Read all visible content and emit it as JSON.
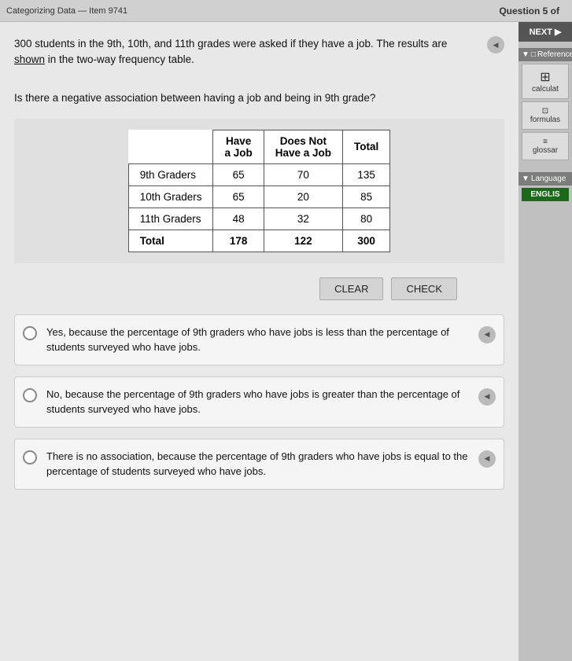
{
  "header": {
    "title": "Categorizing Data — Item 9741",
    "question_indicator": "Question 5 of"
  },
  "question": {
    "text_part1": "300 students in the 9th, 10th, and 11th grades were asked if they have a job. The results are ",
    "text_link": "shown",
    "text_part2": " in the two-way frequency table.",
    "sub_question": "Is there a negative association between having a job and being in 9th grade?"
  },
  "table": {
    "headers": [
      "",
      "Have a Job",
      "Does Not Have a Job",
      "Total"
    ],
    "rows": [
      [
        "9th Graders",
        "65",
        "70",
        "135"
      ],
      [
        "10th Graders",
        "65",
        "20",
        "85"
      ],
      [
        "11th Graders",
        "48",
        "32",
        "80"
      ],
      [
        "Total",
        "178",
        "122",
        "300"
      ]
    ]
  },
  "buttons": {
    "clear": "CLEAR",
    "check": "CHECK"
  },
  "answers": [
    {
      "id": "A",
      "text": "Yes, because the percentage of 9th graders who have jobs is less than the percentage of students surveyed who have jobs."
    },
    {
      "id": "B",
      "text": "No, because the percentage of 9th graders who have jobs is greater than the percentage of students surveyed who have jobs."
    },
    {
      "id": "C",
      "text": "There is no association, because the percentage of 9th graders who have jobs is equal to the percentage of students surveyed who have jobs."
    }
  ],
  "sidebar": {
    "next_label": "NEXT",
    "reference_label": "Reference",
    "calculator_label": "calculat",
    "formula_label": "formulas",
    "glossary_label": "glossar",
    "language_label": "Language",
    "english_label": "ENGLIS"
  }
}
